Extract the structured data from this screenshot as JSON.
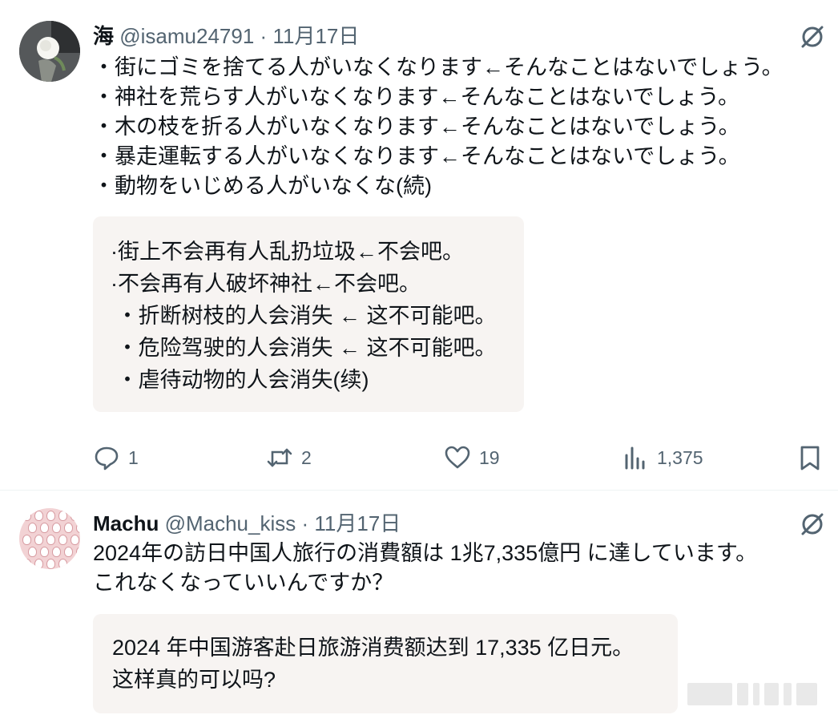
{
  "posts": [
    {
      "name": "海",
      "handle": "@isamu24791",
      "separator": "·",
      "date": "11月17日",
      "lines": [
        "・街にゴミを捨てる人がいなくなります←そんなことはないでしょう。",
        "・神社を荒らす人がいなくなります←そんなことはないでしょう。",
        "・木の枝を折る人がいなくなります←そんなことはないでしょう。",
        "・暴走運転する人がいなくなります←そんなことはないでしょう。",
        "・動物をいじめる人がいなくな(続)"
      ],
      "translation": [
        "·街上不会再有人乱扔垃圾←不会吧。",
        "·不会再有人破坏神社←不会吧。",
        " ・折断树枝的人会消失 ← 这不可能吧。",
        " ・危险驾驶的人会消失 ← 这不可能吧。",
        " ・虐待动物的人会消失(续)"
      ],
      "stats": {
        "replies": "1",
        "retweets": "2",
        "likes": "19",
        "views": "1,375"
      },
      "icons": [
        "translate-icon",
        "reply-icon",
        "retweet-icon",
        "like-icon",
        "views-icon",
        "bookmark-icon"
      ]
    },
    {
      "name": "Machu",
      "handle": "@Machu_kiss",
      "separator": "·",
      "date": "11月17日",
      "lines": [
        "2024年の訪日中国人旅行の消費額は 1兆7,335億円 に達しています。",
        "これなくなっていいんですか？"
      ],
      "translation": [
        "2024 年中国游客赴日旅游消费额达到 17,335 亿日元。",
        "这样真的可以吗?"
      ],
      "icons": [
        "translate-icon"
      ]
    }
  ],
  "colors": {
    "text": "#0f1419",
    "secondary": "#536471",
    "translation_bg": "#f7f4f2",
    "divider": "#eff3f4"
  }
}
